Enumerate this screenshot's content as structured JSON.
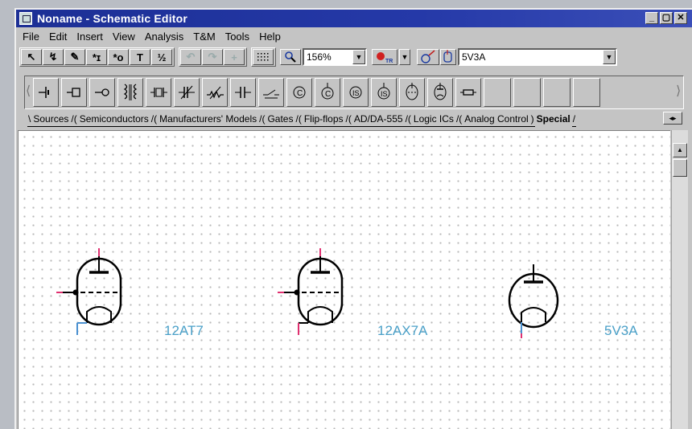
{
  "window": {
    "title": "Noname - Schematic Editor"
  },
  "title_buttons": [
    "_",
    "▢",
    "✕"
  ],
  "menu": [
    "File",
    "Edit",
    "Insert",
    "View",
    "Analysis",
    "T&M",
    "Tools",
    "Help"
  ],
  "toolbar": {
    "zoom_value": "156%",
    "component_value": "5V3A",
    "buttons": [
      {
        "name": "pointer",
        "glyph": "↖"
      },
      {
        "name": "wire",
        "glyph": "↯"
      },
      {
        "name": "pen",
        "glyph": "✎"
      },
      {
        "name": "text-i",
        "glyph": "*ɪ"
      },
      {
        "name": "text-o",
        "glyph": "*o"
      },
      {
        "name": "text",
        "glyph": "T"
      },
      {
        "name": "fraction",
        "glyph": "½"
      }
    ],
    "disabled_buttons": [
      "↶",
      "↷",
      "+"
    ]
  },
  "parts": [
    {
      "name": "battery",
      "glyph": "⊣"
    },
    {
      "name": "lamp",
      "glyph": "⊸"
    },
    {
      "name": "probe",
      "glyph": "−○"
    },
    {
      "name": "transformer",
      "glyph": "⅃⁝Ɛ"
    },
    {
      "name": "crystal",
      "glyph": "⌸"
    },
    {
      "name": "variable-capacitor",
      "glyph": "⫲"
    },
    {
      "name": "potentiometer",
      "glyph": "⩘"
    },
    {
      "name": "capacitor",
      "glyph": "⊣⊢"
    },
    {
      "name": "switch",
      "glyph": "⩦"
    },
    {
      "name": "ic-1",
      "glyph": "Ⓒ"
    },
    {
      "name": "ic-2",
      "glyph": "Ⓒ"
    },
    {
      "name": "ic-3",
      "glyph": "Ⓢ"
    },
    {
      "name": "ic-4",
      "glyph": "Ⓢ"
    },
    {
      "name": "tube",
      "glyph": "⊕"
    },
    {
      "name": "tube-2",
      "glyph": "⊕"
    },
    {
      "name": "fuse",
      "glyph": "▭"
    }
  ],
  "tabs": [
    "Sources",
    "Semiconductors",
    "Manufacturers' Models",
    "Gates",
    "Flip-flops",
    "AD/DA-555",
    "Logic ICs",
    "Analog Control",
    "Special"
  ],
  "components": [
    {
      "label": "12AT7",
      "type": "triode"
    },
    {
      "label": "12AX7A",
      "type": "triode"
    },
    {
      "label": "5V3A",
      "type": "diode"
    }
  ],
  "colors": {
    "title_bar": "#1c2f95",
    "label": "#4aa0c8",
    "pin_red": "#e03070",
    "pin_blue": "#4a90d0"
  }
}
